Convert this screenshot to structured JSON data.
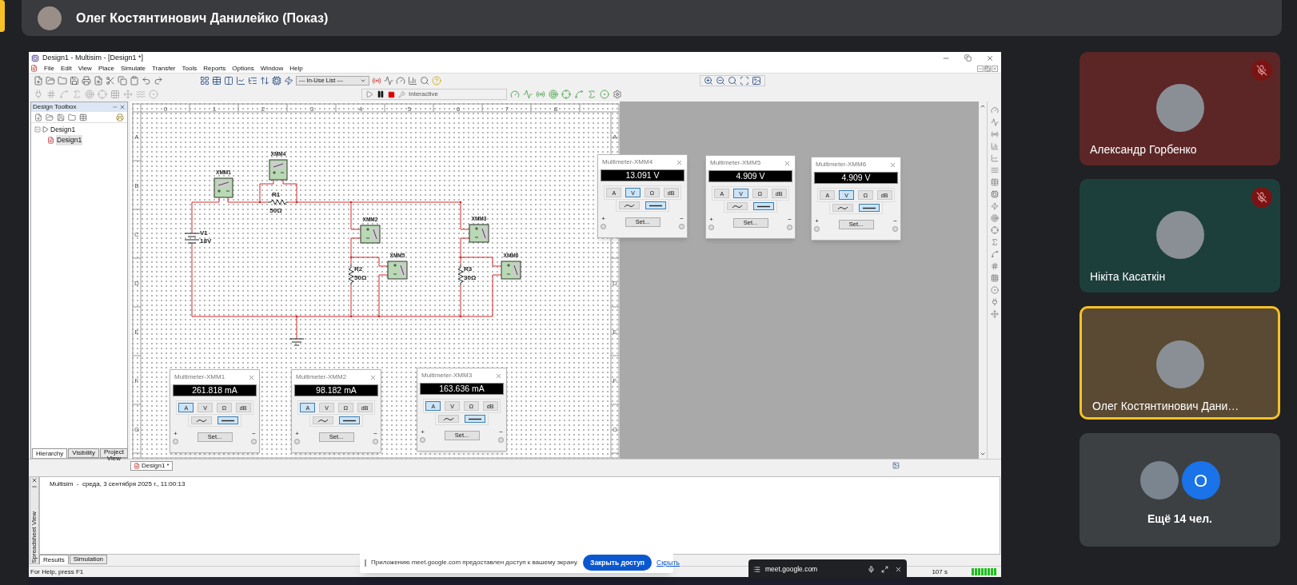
{
  "meet_header": {
    "presenter": "Олег Костянтинович Данилейко (Показ)"
  },
  "app": {
    "title": "Design1 - Multisim - [Design1 *]",
    "menu": [
      "File",
      "Edit",
      "View",
      "Place",
      "Simulate",
      "Transfer",
      "Tools",
      "Reports",
      "Options",
      "Window",
      "Help"
    ],
    "component_list": "--- In-Use List ---",
    "sim_mode": "Interactive",
    "toolbox": {
      "title": "Design Toolbox",
      "tree": [
        {
          "label": "Design1",
          "expanded": true,
          "children": [
            {
              "label": "Design1",
              "selected": true
            }
          ]
        }
      ],
      "tabs": [
        {
          "label": "Hierarchy",
          "selected": true
        },
        {
          "label": "Visibility",
          "selected": false
        },
        {
          "label": "Project View",
          "selected": false
        }
      ]
    },
    "sheet": {
      "columns": [
        "0",
        "1",
        "2",
        "3",
        "4",
        "5",
        "6",
        "7",
        "8"
      ],
      "rows_left": [
        "A",
        "B",
        "C",
        "D",
        "E",
        "F",
        "G"
      ],
      "rows_right": [
        "A",
        "D",
        "E",
        "F",
        "G"
      ]
    },
    "circuit": {
      "instruments": [
        "XMM1",
        "XMM4",
        "XMM2",
        "XMM5",
        "XMM3",
        "XMM6"
      ],
      "source": {
        "name": "V1",
        "value": "18V"
      },
      "resistors": [
        {
          "name": "R1",
          "value": "50Ω"
        },
        {
          "name": "R2",
          "value": "50Ω"
        },
        {
          "name": "R3",
          "value": "30Ω"
        }
      ]
    },
    "meters": [
      {
        "title": "Multimeter-XMM1",
        "reading": "261.818 mA",
        "modes": [
          {
            "label": "A",
            "selected": true
          },
          {
            "label": "V",
            "selected": false
          },
          {
            "label": "Ω",
            "selected": false
          },
          {
            "label": "dB",
            "selected": false
          }
        ],
        "coupling": [
          {
            "kind": "ac",
            "selected": false
          },
          {
            "kind": "dc",
            "selected": true
          }
        ],
        "set": "Set...",
        "plus": "+",
        "minus": "−"
      },
      {
        "title": "Multimeter-XMM2",
        "reading": "98.182 mA",
        "modes": [
          {
            "label": "A",
            "selected": true
          },
          {
            "label": "V",
            "selected": false
          },
          {
            "label": "Ω",
            "selected": false
          },
          {
            "label": "dB",
            "selected": false
          }
        ],
        "coupling": [
          {
            "kind": "ac",
            "selected": false
          },
          {
            "kind": "dc",
            "selected": true
          }
        ],
        "set": "Set...",
        "plus": "+",
        "minus": "−"
      },
      {
        "title": "Multimeter-XMM3",
        "reading": "163.636 mA",
        "modes": [
          {
            "label": "A",
            "selected": true
          },
          {
            "label": "V",
            "selected": false
          },
          {
            "label": "Ω",
            "selected": false
          },
          {
            "label": "dB",
            "selected": false
          }
        ],
        "coupling": [
          {
            "kind": "ac",
            "selected": false
          },
          {
            "kind": "dc",
            "selected": true
          }
        ],
        "set": "Set...",
        "plus": "+",
        "minus": "−"
      },
      {
        "title": "Multimeter-XMM4",
        "reading": "13.091 V",
        "modes": [
          {
            "label": "A",
            "selected": false
          },
          {
            "label": "V",
            "selected": true
          },
          {
            "label": "Ω",
            "selected": false
          },
          {
            "label": "dB",
            "selected": false
          }
        ],
        "coupling": [
          {
            "kind": "ac",
            "selected": false
          },
          {
            "kind": "dc",
            "selected": true
          }
        ],
        "set": "Set...",
        "plus": "+",
        "minus": "−"
      },
      {
        "title": "Multimeter-XMM5",
        "reading": "4.909 V",
        "modes": [
          {
            "label": "A",
            "selected": false
          },
          {
            "label": "V",
            "selected": true
          },
          {
            "label": "Ω",
            "selected": false
          },
          {
            "label": "dB",
            "selected": false
          }
        ],
        "coupling": [
          {
            "kind": "ac",
            "selected": false
          },
          {
            "kind": "dc",
            "selected": true
          }
        ],
        "set": "Set...",
        "plus": "+",
        "minus": "−"
      },
      {
        "title": "Multimeter-XMM6",
        "reading": "4.909 V",
        "modes": [
          {
            "label": "A",
            "selected": false
          },
          {
            "label": "V",
            "selected": true
          },
          {
            "label": "Ω",
            "selected": false
          },
          {
            "label": "dB",
            "selected": false
          }
        ],
        "coupling": [
          {
            "kind": "ac",
            "selected": false
          },
          {
            "kind": "dc",
            "selected": true
          }
        ],
        "set": "Set...",
        "plus": "+",
        "minus": "−"
      }
    ],
    "design_tabs": [
      {
        "label": "Design1 *",
        "selected": true
      }
    ],
    "spreadsheet": {
      "title": "Spreadsheet View",
      "log": [
        "Multisim  -  среда, 3 сентября 2025 г., 11:00:13"
      ],
      "tabs": [
        {
          "label": "Results",
          "selected": true
        },
        {
          "label": "Simulation",
          "selected": false
        }
      ]
    },
    "status_bar": {
      "help": "For Help, press F1",
      "elapsed": "107 s"
    }
  },
  "share_notice": {
    "message": "Приложению meet.google.com предоставлен доступ к вашему экрану.",
    "stop_button": "Закрыть доступ",
    "hide_link": "Скрыть"
  },
  "mini_window": {
    "title": "meet.google.com"
  },
  "participants": [
    {
      "kind": "person",
      "name": "Александр Горбенко",
      "muted": true,
      "active": false,
      "color": "#5c2626"
    },
    {
      "kind": "person",
      "name": "Нікіта Касаткін",
      "muted": true,
      "active": false,
      "color": "#1d3f3c"
    },
    {
      "kind": "person",
      "name": "Олег Костянтинович Дани…",
      "muted": false,
      "active": true,
      "color": "#5a4a33"
    },
    {
      "kind": "more",
      "name": "Ещё 14 чел.",
      "initial": "О",
      "muted": false,
      "active": false,
      "color": "#3c4043"
    }
  ]
}
